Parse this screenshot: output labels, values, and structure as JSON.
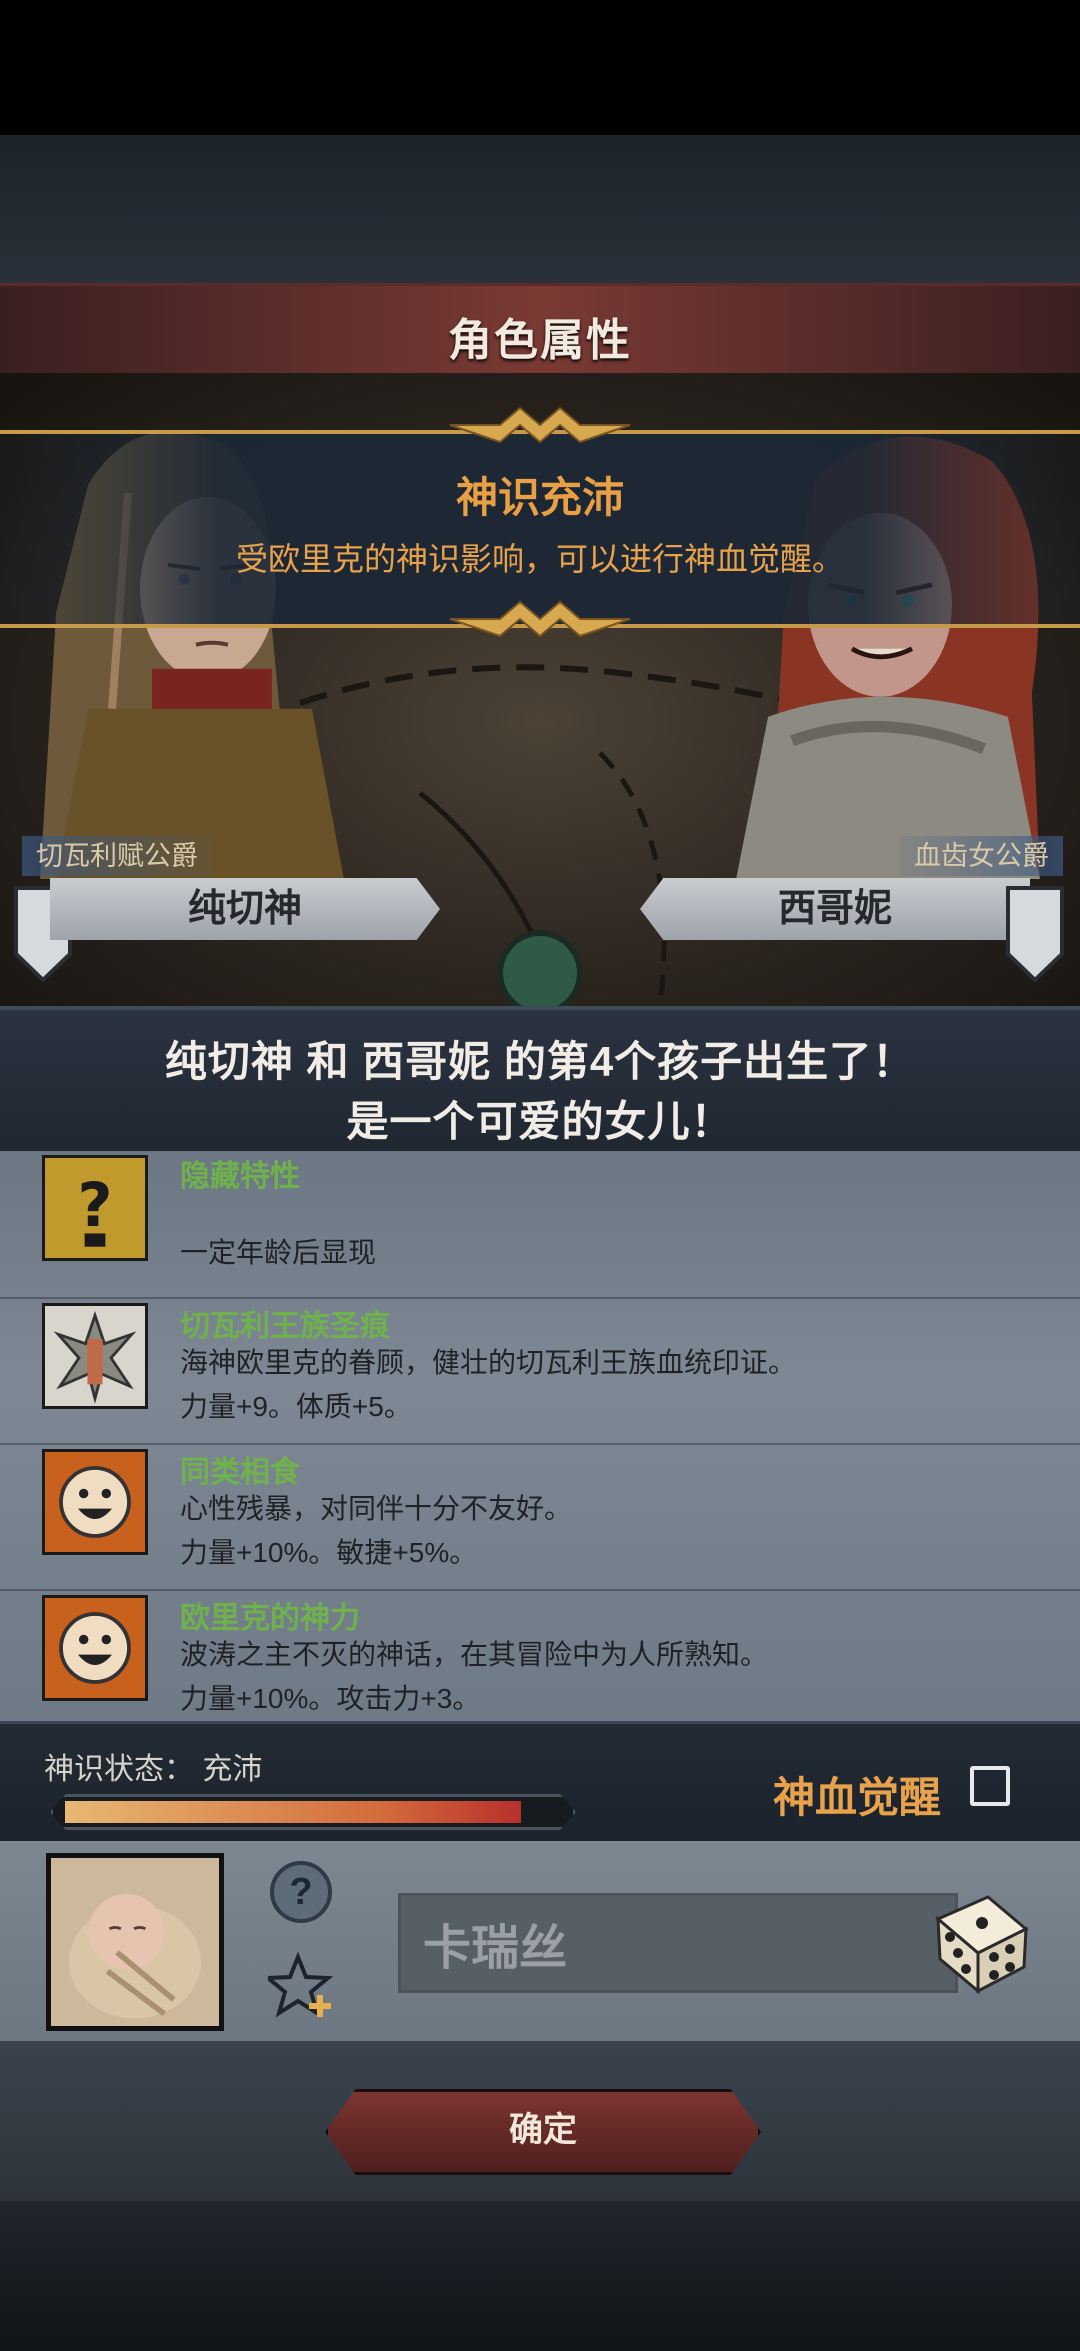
{
  "window": {
    "title": "角色属性"
  },
  "event": {
    "title": "神识充沛",
    "description": "受欧里克的神识影响，可以进行神血觉醒。"
  },
  "parents": {
    "father": {
      "title": "切瓦利赋公爵",
      "name": "纯切神"
    },
    "mother": {
      "title": "血齿女公爵",
      "name": "西哥妮"
    }
  },
  "birth": {
    "line1": "纯切神 和 西哥妮 的第4个孩子出生了！",
    "line2": "是一个可爱的女儿！"
  },
  "traits": [
    {
      "name": "隐藏特性",
      "desc1": "",
      "desc2": "一定年龄后显现",
      "icon": "question-mark-icon"
    },
    {
      "name": "切瓦利王族圣痕",
      "desc1": "海神欧里克的眷顾，健壮的切瓦利王族血统印证。",
      "desc2": "力量+9。体质+5。",
      "icon": "royal-stigma-icon"
    },
    {
      "name": "同类相食",
      "desc1": "心性残暴，对同伴十分不友好。",
      "desc2": "力量+10%。敏捷+5%。",
      "icon": "smiley-face-icon"
    },
    {
      "name": "欧里克的神力",
      "desc1": "波涛之主不灭的神话，在其冒险中为人所熟知。",
      "desc2": "力量+10%。攻击力+3。",
      "icon": "smiley-face-icon"
    }
  ],
  "status": {
    "label": "神识状态： 充沛",
    "progress": 0.92,
    "awaken_label": "神血觉醒",
    "awaken_checked": false
  },
  "child": {
    "name": "卡瑞丝",
    "help_symbol": "?"
  },
  "footer": {
    "confirm_label": "确定"
  },
  "colors": {
    "trait_name": "#6fb24c",
    "accent_orange": "#e9a045",
    "title_bar": "#7a3a34"
  }
}
